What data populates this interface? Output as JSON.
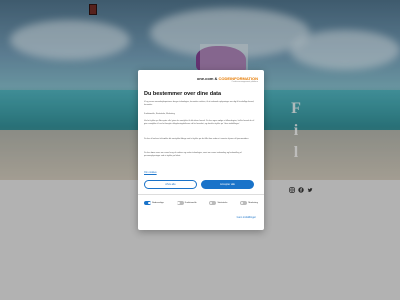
{
  "hero": {
    "side_letters": [
      "F",
      "i",
      "l"
    ]
  },
  "social": [
    "instagram-icon",
    "facebook-icon",
    "twitter-icon"
  ],
  "consent": {
    "brand": "one.com & ",
    "brand_accent": "CODEINFORMATION",
    "brand_sub": "Cookie-management platform",
    "title": "Du bestemmer over dine data",
    "intro": "Vi og vores samarbejdspartnere bruger teknologier, herunder cookies, til at indsamle oplysninger om dig til forskellige formål, herunder:",
    "purposes": "Funktionelle, Statistiske, Marketing",
    "body1": "Ved at trykke på 'Accepter alle' giver du samtykke til alle disse formål. Du kan også vælge at tilkendegive, hvilke formål du vil give samtykke til ved at benytte afkrydsningsfelterne ud for formålet, og derefter trykke på 'Gem indstillinger'.",
    "body2": "Du kan til enhver tid trække dit samtykke tilbage ved at trykke på det lille ikon nederst i venstre hjørne af hjemmesiden.",
    "body3": "Du kan læse mere om vores brug af cookies og andre teknologier, samt om vores indsamling og behandling af personoplysninger ved at trykke på linket.",
    "link": "Om cookies",
    "reject_label": "Afvis alle",
    "accept_label": "Accepter alle",
    "toggles": [
      {
        "label": "Nødvendige",
        "on": true
      },
      {
        "label": "Funktionelle",
        "on": false
      },
      {
        "label": "Statistiske",
        "on": false
      },
      {
        "label": "Marketing",
        "on": false
      }
    ],
    "save_label": "Gem indstillinger",
    "accent_color": "#1a73c9"
  }
}
